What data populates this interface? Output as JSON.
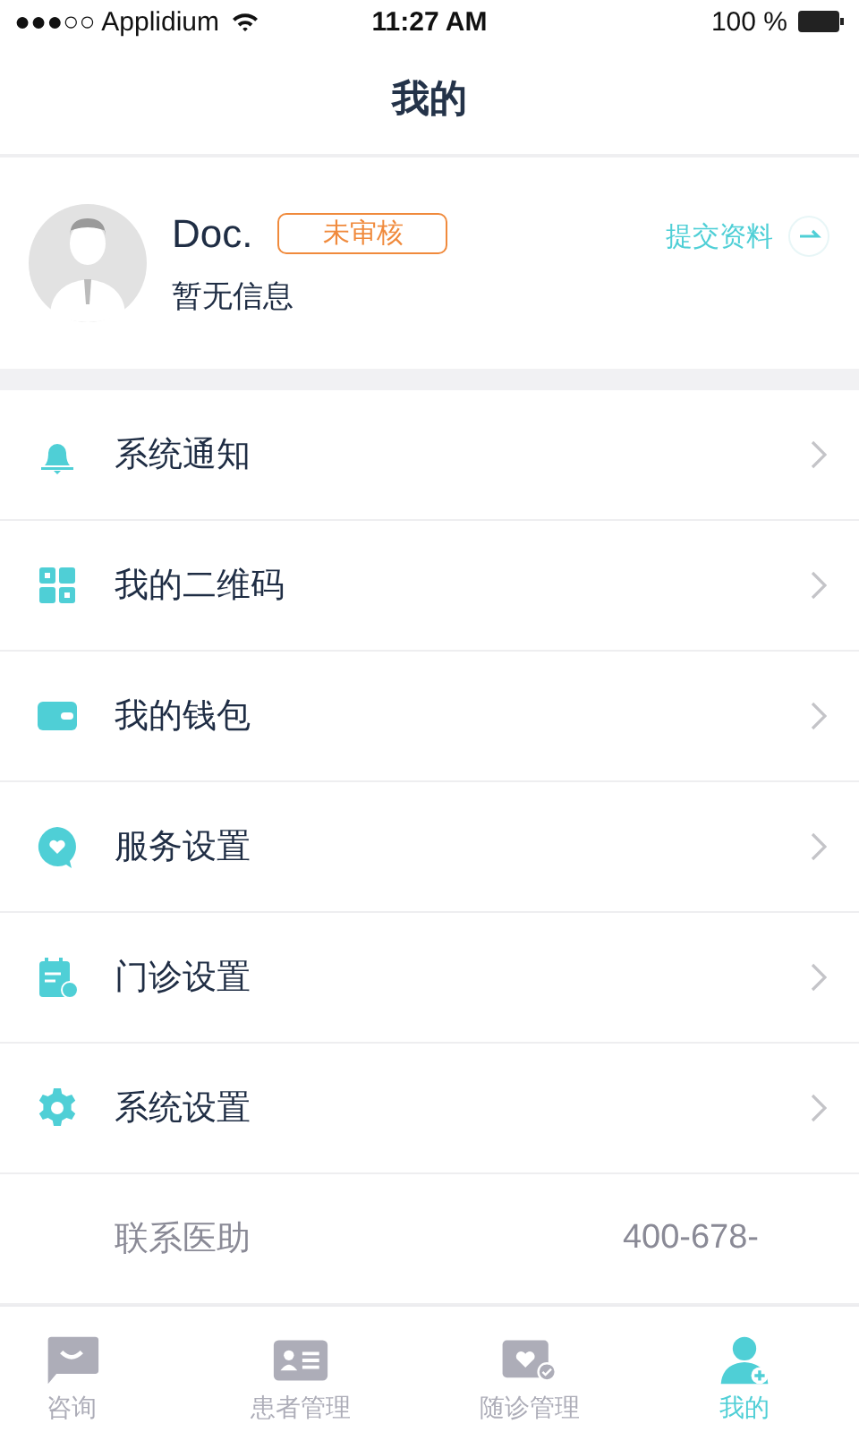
{
  "status_bar": {
    "carrier": "●●●○○ Applidium",
    "time": "11:27 AM",
    "battery": "100 %"
  },
  "nav": {
    "title": "我的"
  },
  "profile": {
    "name": "Doc.",
    "badge": "未审核",
    "info": "暂无信息",
    "action": "提交资料"
  },
  "menu": [
    {
      "label": "系统通知"
    },
    {
      "label": "我的二维码"
    },
    {
      "label": "我的钱包"
    },
    {
      "label": "服务设置"
    },
    {
      "label": "门诊设置"
    },
    {
      "label": "系统设置"
    }
  ],
  "contact": {
    "label": "联系医助",
    "phone": "400-678-"
  },
  "tabs": [
    {
      "label": "咨询",
      "selected": false
    },
    {
      "label": "患者管理",
      "selected": false
    },
    {
      "label": "随诊管理",
      "selected": false
    },
    {
      "label": "我的",
      "selected": true
    }
  ]
}
